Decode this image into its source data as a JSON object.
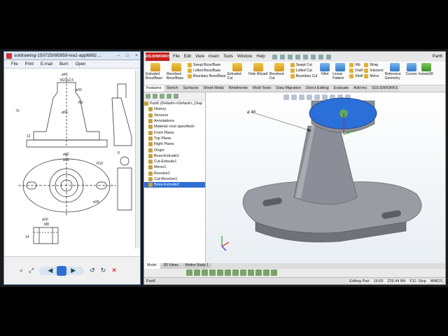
{
  "viewer": {
    "title": "soldrawing-150725095959-lva1-app6892 ...",
    "menu": [
      "File",
      "Print",
      "E-mail",
      "Burn",
      "Open"
    ],
    "bottom_icons": [
      "zoom-icon",
      "fit-icon",
      "prev-icon",
      "slideshow-icon",
      "next-icon",
      "rotate-left-icon",
      "rotate-right-icon",
      "delete-icon"
    ],
    "drawing_dims": [
      "ø45",
      "M21x2,5",
      "ø30",
      "R5",
      "ø65",
      "ø80",
      "ø98",
      "12",
      "70",
      "R10",
      "ø36",
      "ø30",
      "M8",
      "14",
      "8"
    ]
  },
  "sw": {
    "logo": "SOLIDWORKS",
    "menu": [
      "File",
      "Edit",
      "View",
      "Insert",
      "Tools",
      "Window",
      "Help"
    ],
    "part_title": "Part6",
    "ribbon": {
      "big1": "Extruded Boss/Base",
      "big2": "Revolved Boss/Base",
      "col1": [
        "Swept Boss/Base",
        "Lofted Boss/Base",
        "Boundary Boss/Base"
      ],
      "big3": "Extruded Cut",
      "big4": "Hole Wizard",
      "big5": "Revolved Cut",
      "col2": [
        "Swept Cut",
        "Lofted Cut",
        "Boundary Cut"
      ],
      "big6": "Fillet",
      "big7": "Linear Pattern",
      "col3": [
        "Rib",
        "Draft",
        "Shell"
      ],
      "col4": [
        "Wrap",
        "Intersect",
        "Mirror"
      ],
      "big8": "Reference Geometry",
      "big9": "Curves",
      "big10": "Instant3D"
    },
    "tabs": [
      "Features",
      "Sketch",
      "Surfaces",
      "Sheet Metal",
      "Weldments",
      "Mold Tools",
      "Data Migration",
      "Direct Editing",
      "Evaluate",
      "Add-Ins",
      "SOLIDWORKS"
    ],
    "tree": [
      "Part6 (Default<<Default>_Disp",
      "History",
      "Sensors",
      "Annotations",
      "Material <not specified>",
      "Front Plane",
      "Top Plane",
      "Right Plane",
      "Origin",
      "Boss-Extrude1",
      "Cut-Extrude1",
      "Mirror1",
      "Revolve1",
      "Cut-Revolve1",
      "Boss-Extrude2"
    ],
    "bottom_tabs": [
      "Model",
      "3D Views",
      "Motion Study 1"
    ],
    "dimension_label": "ø 48",
    "status_left": "Part6",
    "status_right": [
      "Editing Part",
      "MMGS"
    ],
    "clock": "16:09",
    "mem": "229.44 Mb",
    "fps": "F11: Stop"
  },
  "colors": {
    "face": "#2b6fd8",
    "body": "#8b8e96",
    "bg_top": "#ffffff",
    "bg_bottom": "#e9eef3"
  }
}
